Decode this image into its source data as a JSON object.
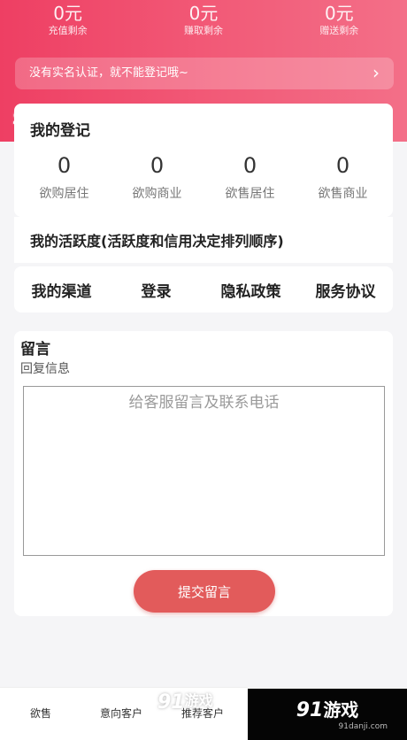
{
  "balances": [
    {
      "value": "0元",
      "label": "充值剩余"
    },
    {
      "value": "0元",
      "label": "赚取剩余"
    },
    {
      "value": "0元",
      "label": "赠送剩余"
    }
  ],
  "notice": {
    "text": "没有实名认证，就不能登记哦~",
    "chevron": "›"
  },
  "watermark": {
    "num": "91",
    "cn": "游戏",
    "url": "91danji.com"
  },
  "registration": {
    "title": "我的登记",
    "stats": [
      {
        "value": "0",
        "label": "欲购居住"
      },
      {
        "value": "0",
        "label": "欲购商业"
      },
      {
        "value": "0",
        "label": "欲售居住"
      },
      {
        "value": "0",
        "label": "欲售商业"
      }
    ]
  },
  "activity": {
    "title": "我的活跃度(活跃度和信用决定排列顺序)"
  },
  "nav": [
    "我的渠道",
    "登录",
    "隐私政策",
    "服务协议"
  ],
  "message": {
    "heading": "留言",
    "subheading": "回复信息",
    "placeholder": "给客服留言及联系电话",
    "submit_label": "提交留言"
  },
  "tabs": [
    "欲售",
    "意向客户",
    "推荐客户"
  ],
  "colors": {
    "header": "#ee3f63",
    "button": "#e25b5b"
  }
}
